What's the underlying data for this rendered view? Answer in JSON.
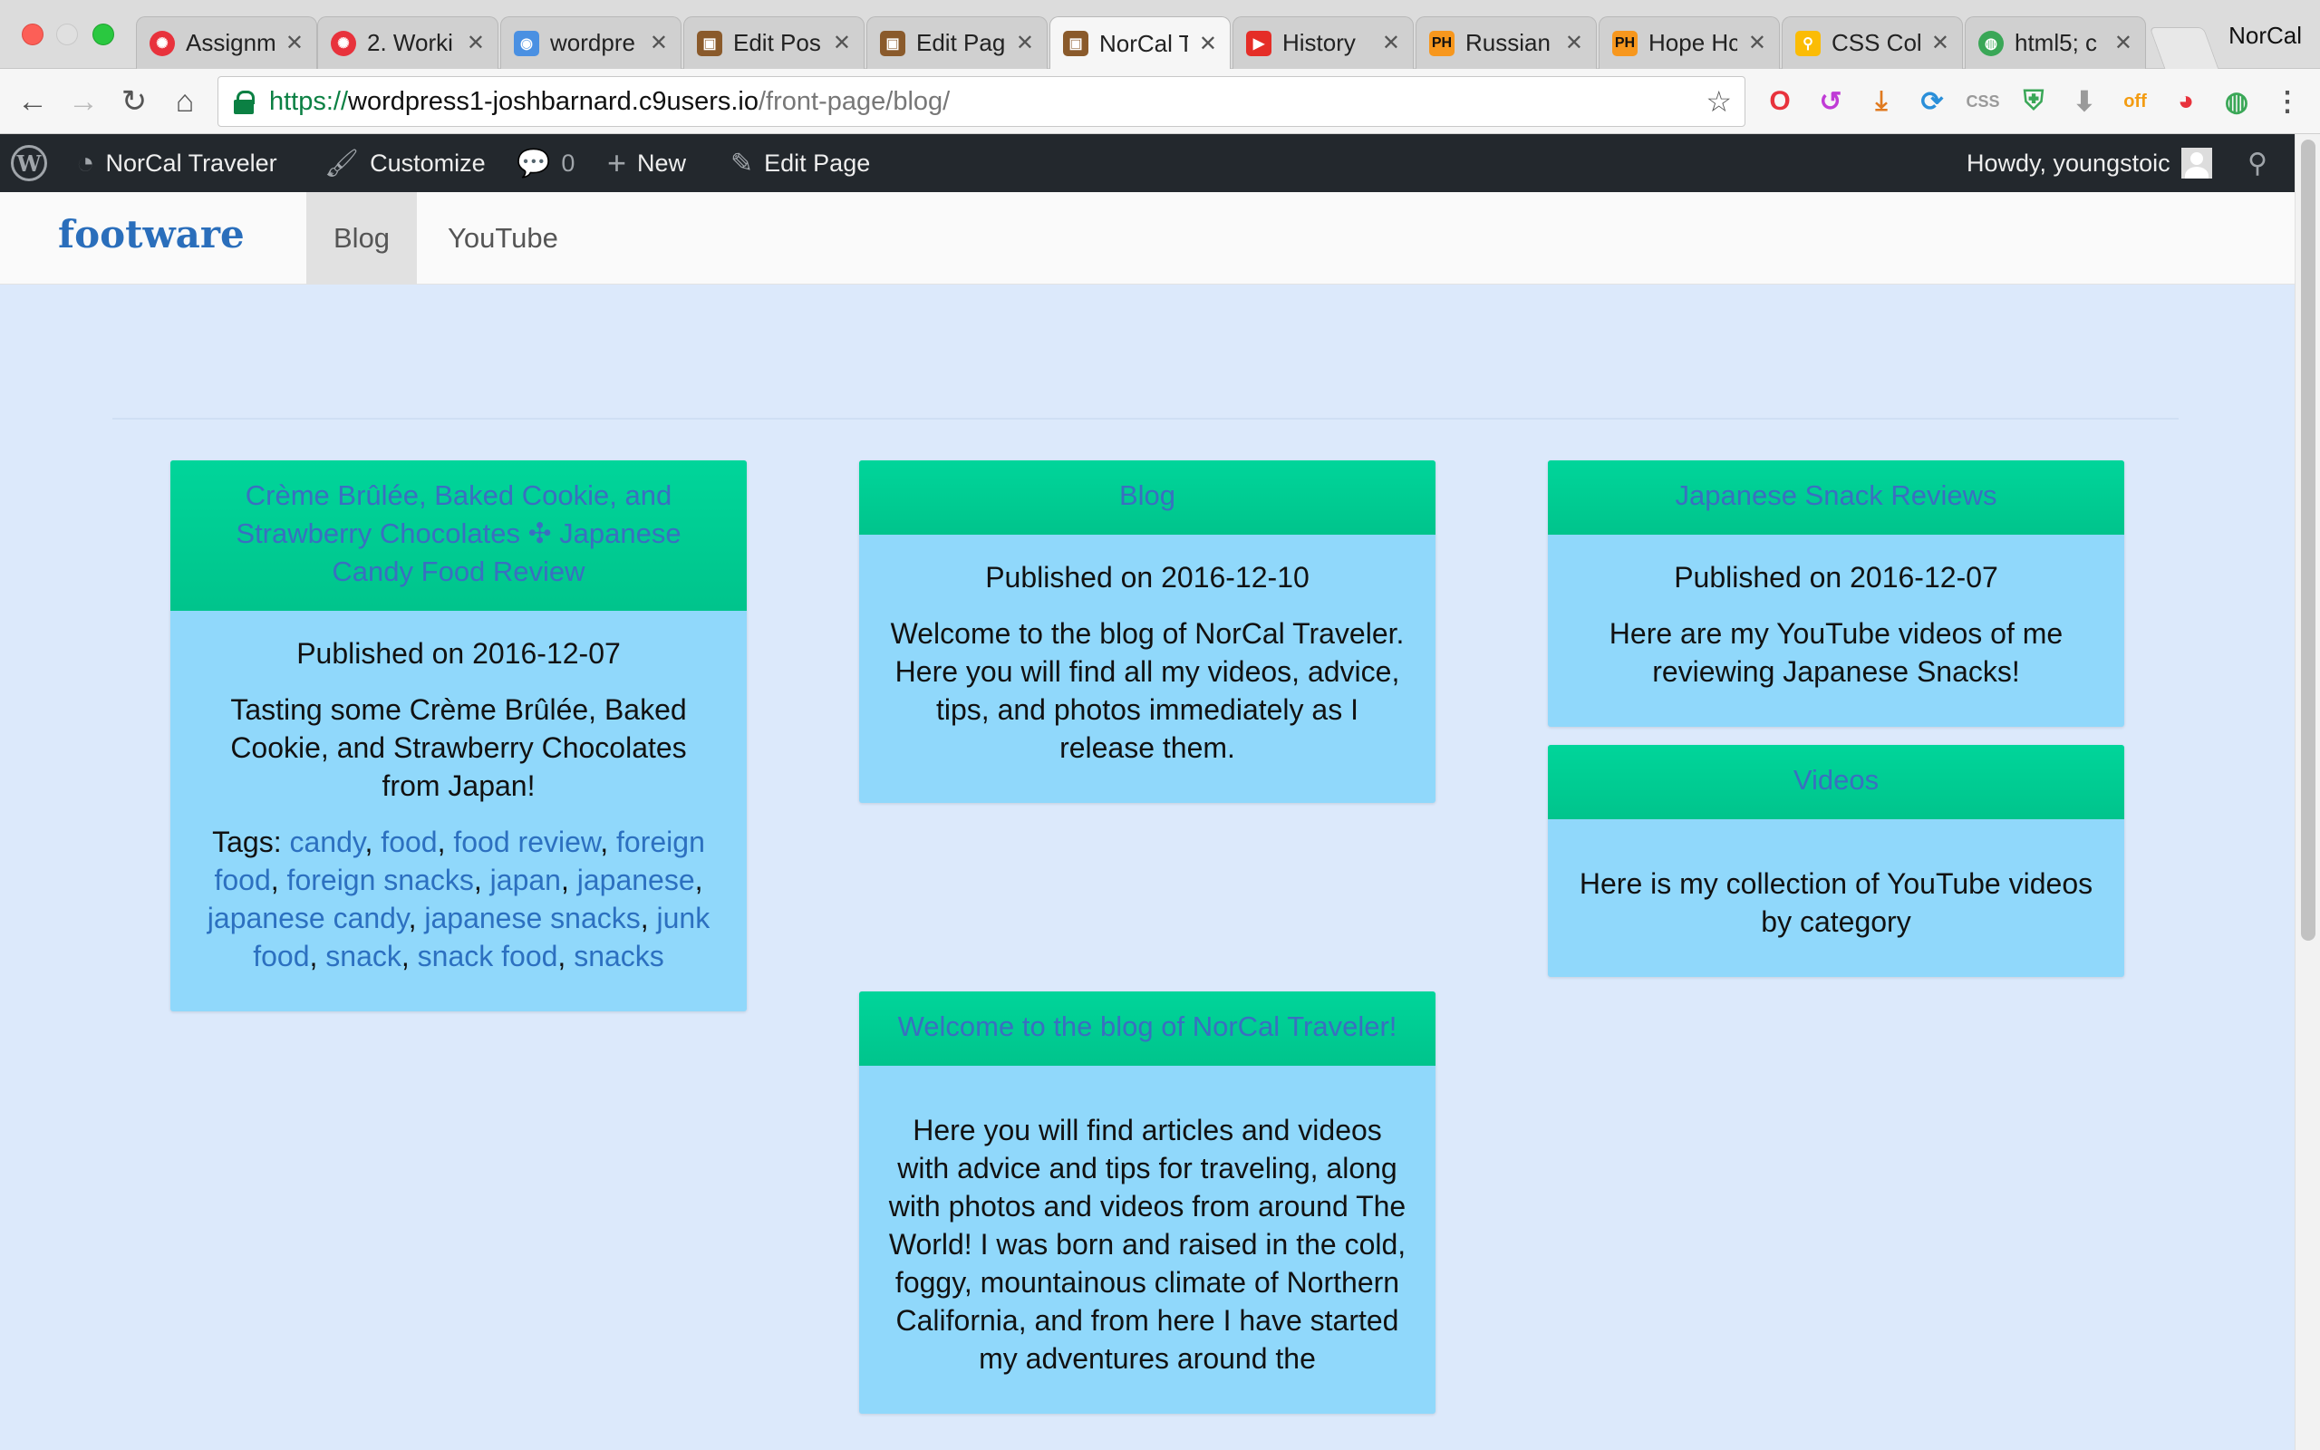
{
  "browser": {
    "tabs": [
      {
        "title": "Assignm",
        "favicon": "red-gear-icon"
      },
      {
        "title": "2. Worki",
        "favicon": "red-gear-icon"
      },
      {
        "title": "wordpre",
        "favicon": "blue-eye-icon"
      },
      {
        "title": "Edit Pos",
        "favicon": "suitcase-icon"
      },
      {
        "title": "Edit Pag",
        "favicon": "suitcase-icon"
      },
      {
        "title": "NorCal T",
        "favicon": "suitcase-icon",
        "active": true
      },
      {
        "title": "History",
        "favicon": "youtube-icon"
      },
      {
        "title": "Russian",
        "favicon": "ph-icon"
      },
      {
        "title": "Hope Hc",
        "favicon": "ph-icon"
      },
      {
        "title": "CSS Col",
        "favicon": "search-icon"
      },
      {
        "title": "html5; c",
        "favicon": "globe-icon"
      }
    ],
    "profile": "NorCal",
    "url": {
      "scheme": "https://",
      "host": "wordpress1-joshbarnard.c9users.io",
      "path": "/front-page/blog/"
    }
  },
  "adminbar": {
    "site": "NorCal Traveler",
    "customize": "Customize",
    "comments": "0",
    "new": "New",
    "edit": "Edit Page",
    "howdy": "Howdy, youngstoic"
  },
  "nav": {
    "brand": "footware",
    "links": [
      "Blog",
      "YouTube"
    ]
  },
  "posts": [
    {
      "title": "Crème Brûlée, Baked Cookie, and Strawberry Chocolates ✣ Japanese Candy Food Review",
      "published": "Published on 2016-12-07",
      "body": "Tasting some Crème Brûlée, Baked Cookie, and Strawberry Chocolates from Japan!",
      "tags_label": "Tags:",
      "tags": [
        "candy",
        "food",
        "food review",
        "foreign food",
        "foreign snacks",
        "japan",
        "japanese",
        "japanese candy",
        "japanese snacks",
        "junk food",
        "snack",
        "snack food",
        "snacks"
      ]
    },
    {
      "title": "Blog",
      "published": "Published on 2016-12-10",
      "body": "Welcome to the blog of NorCal Traveler. Here you will find all my videos, advice, tips, and photos immediately as I release them."
    },
    {
      "title": "Japanese Snack Reviews",
      "published": "Published on 2016-12-07",
      "body": "Here are my YouTube videos of me reviewing Japanese Snacks!"
    },
    {
      "title": "Videos",
      "body": "Here is my collection of YouTube videos by category"
    },
    {
      "title": "Welcome to the blog of NorCal Traveler!",
      "body": "Here you will find articles and videos with advice and tips for traveling, along with photos and videos from around The World! I was born and raised in the cold, foggy, mountainous climate of Northern California, and from here I have started my adventures around the"
    }
  ]
}
